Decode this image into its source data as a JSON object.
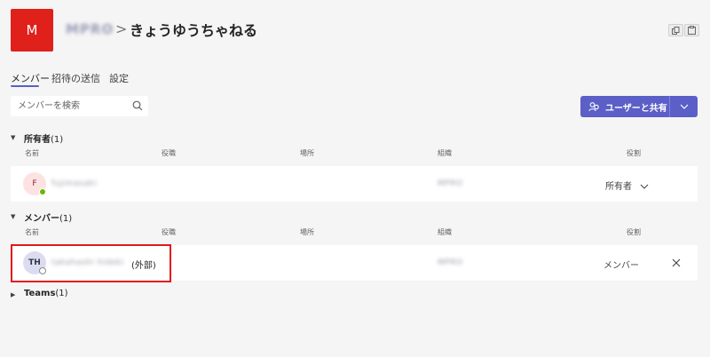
{
  "header": {
    "logo_letter": "M",
    "team_name": "MPRO",
    "separator": ">",
    "channel": "きょうゆうちゃねる",
    "more": "…"
  },
  "tabs": [
    {
      "label": "メンバー",
      "active": true
    },
    {
      "label": "招待の送信",
      "active": false
    },
    {
      "label": "設定",
      "active": false
    }
  ],
  "search": {
    "placeholder": "メンバーを検索",
    "value": ""
  },
  "share": {
    "label": "ユーザーと共有"
  },
  "columns": [
    "名前",
    "役職",
    "場所",
    "組織",
    "役割"
  ],
  "owners": {
    "title": "所有者",
    "count": "(1)",
    "members": [
      {
        "initials": "F",
        "name": "fujimasaki",
        "org": "MPRO",
        "role": "所有者"
      }
    ]
  },
  "members": {
    "title": "メンバー",
    "count": "(1)",
    "members": [
      {
        "initials": "TH",
        "name": "takahashi hideki",
        "external": "(外部)",
        "org": "MPRO",
        "role": "メンバー"
      }
    ]
  },
  "guests": {
    "title": "Teams",
    "count": "(1)"
  },
  "colors": {
    "accent": "#5b5fc7",
    "highlight": "#e4171a",
    "logo": "#e0201a"
  }
}
